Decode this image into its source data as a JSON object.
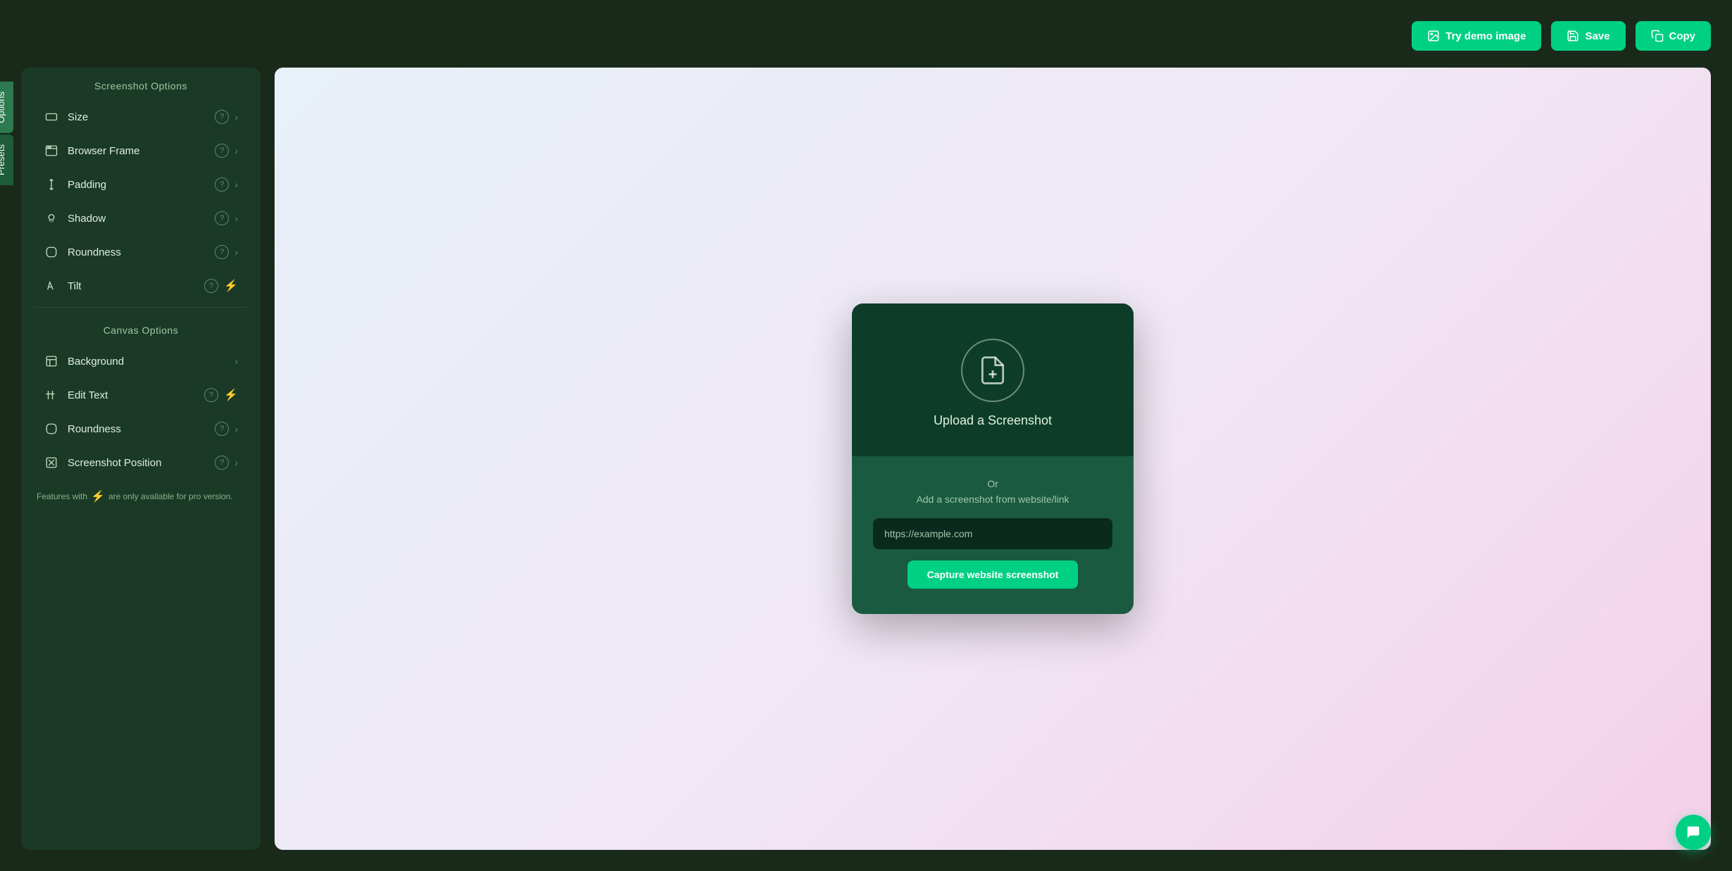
{
  "toolbar": {
    "try_demo_label": "Try demo image",
    "save_label": "Save",
    "copy_label": "Copy"
  },
  "side_tabs": [
    {
      "id": "options",
      "label": "Options",
      "active": true
    },
    {
      "id": "presets",
      "label": "Presets",
      "active": false
    }
  ],
  "panel": {
    "screenshot_section_title": "Screenshot Options",
    "canvas_section_title": "Canvas Options",
    "screenshot_options": [
      {
        "id": "size",
        "label": "Size",
        "has_help": true,
        "has_chevron": true,
        "has_pro": false
      },
      {
        "id": "browser-frame",
        "label": "Browser Frame",
        "has_help": true,
        "has_chevron": true,
        "has_pro": false
      },
      {
        "id": "padding",
        "label": "Padding",
        "has_help": true,
        "has_chevron": true,
        "has_pro": false
      },
      {
        "id": "shadow",
        "label": "Shadow",
        "has_help": true,
        "has_chevron": true,
        "has_pro": false
      },
      {
        "id": "roundness",
        "label": "Roundness",
        "has_help": true,
        "has_chevron": true,
        "has_pro": false
      },
      {
        "id": "tilt",
        "label": "Tilt",
        "has_help": true,
        "has_chevron": false,
        "has_pro": true
      }
    ],
    "canvas_options": [
      {
        "id": "background",
        "label": "Background",
        "has_help": false,
        "has_chevron": true,
        "has_pro": false
      },
      {
        "id": "edit-text",
        "label": "Edit Text",
        "has_help": true,
        "has_chevron": false,
        "has_pro": true
      },
      {
        "id": "roundness-canvas",
        "label": "Roundness",
        "has_help": true,
        "has_chevron": true,
        "has_pro": false
      },
      {
        "id": "screenshot-position",
        "label": "Screenshot Position",
        "has_help": true,
        "has_chevron": true,
        "has_pro": false
      }
    ],
    "pro_note": "Features with ⚡ are only available for pro version."
  },
  "canvas": {
    "upload_title": "Upload a Screenshot",
    "or_text": "Or\nAdd a screenshot from website/link",
    "url_placeholder": "https://example.com",
    "capture_button": "Capture website screenshot"
  },
  "icons": {
    "image": "🖼",
    "save": "💾",
    "copy": "📋",
    "help_symbol": "?",
    "chevron_right": "›",
    "pro": "⚡",
    "chat": "💬"
  }
}
